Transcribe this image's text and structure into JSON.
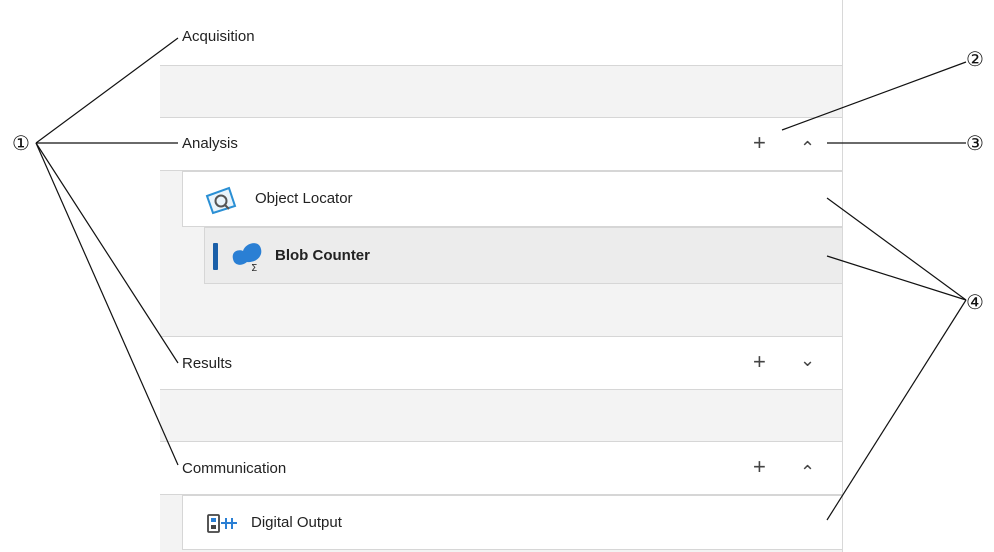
{
  "sections": [
    {
      "title": "Acquisition"
    },
    {
      "title": "Analysis",
      "items": [
        {
          "label": "Object Locator",
          "icon": "object-locator-icon"
        },
        {
          "label": "Blob Counter",
          "icon": "blob-counter-icon",
          "selected": true
        }
      ]
    },
    {
      "title": "Results"
    },
    {
      "title": "Communication",
      "items": [
        {
          "label": "Digital Output",
          "icon": "digital-output-icon"
        }
      ]
    }
  ],
  "controls": {
    "add_symbol": "+",
    "collapse_symbol": "⌃",
    "expand_symbol": "⌄"
  },
  "callouts": {
    "c1": "①",
    "c2": "②",
    "c3": "③",
    "c4": "④"
  },
  "colors": {
    "accent": "#1a5fa8",
    "icon_blue": "#2a7fd4",
    "selected_bg": "#ececec",
    "section_gray": "#f3f3f3"
  }
}
